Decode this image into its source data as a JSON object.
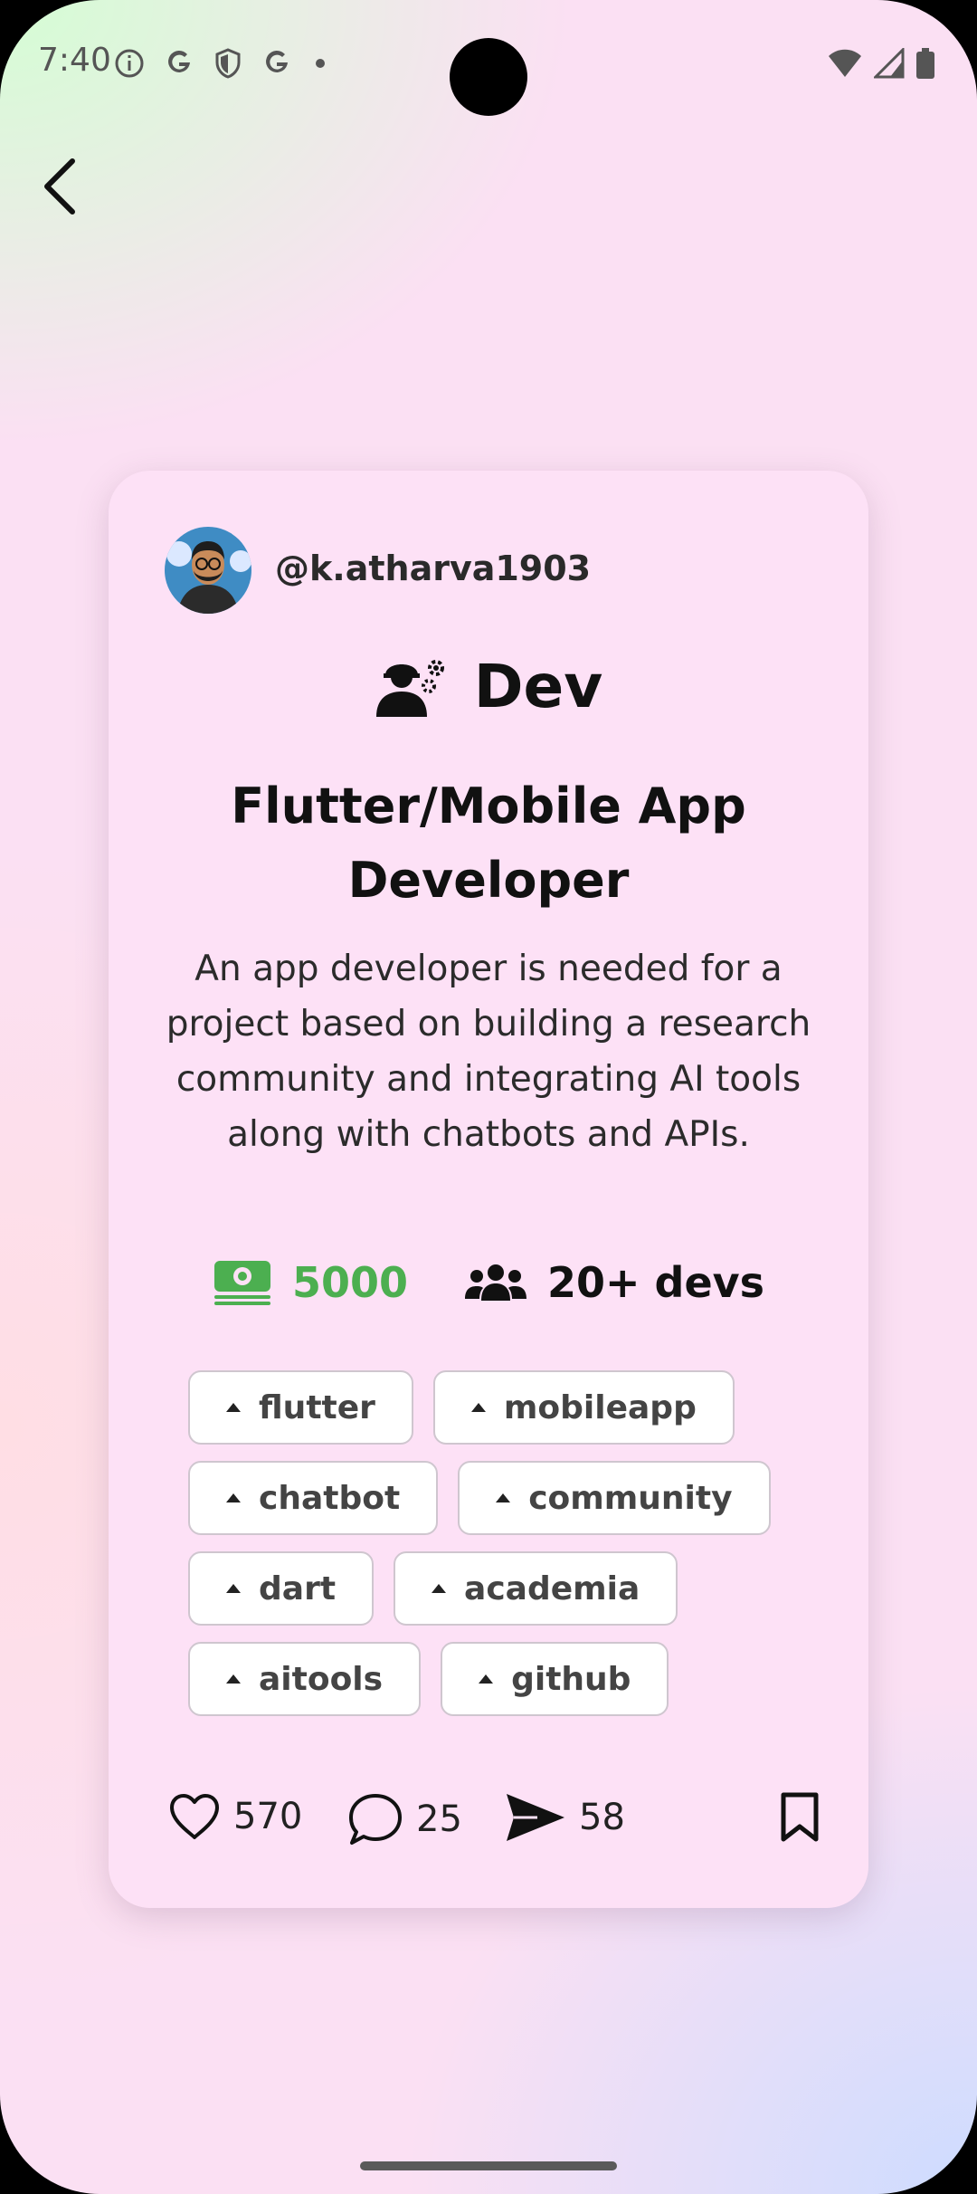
{
  "status_bar": {
    "time": "7:40",
    "left_icons": [
      "info-icon",
      "google-icon",
      "shield-icon",
      "google-icon",
      "dot-icon"
    ],
    "right_icons": [
      "wifi-icon",
      "signal-icon",
      "battery-icon"
    ]
  },
  "nav": {
    "back_icon": "chevron-left-icon"
  },
  "post": {
    "username": "@k.atharva1903",
    "role_icon": "engineer-gear-icon",
    "role": "Dev",
    "title": "Flutter/Mobile App Developer",
    "description": "An app developer is needed for a project based on building a research community and integrating AI tools along with chatbots and APIs.",
    "budget_icon": "money-icon",
    "budget": "5000",
    "team_icon": "users-icon",
    "team_size": "20+ devs",
    "tags": [
      "flutter",
      "mobileapp",
      "chatbot",
      "community",
      "dart",
      "academia",
      "aitools",
      "github"
    ],
    "likes": "570",
    "comments": "25",
    "shares": "58"
  },
  "colors": {
    "accent_green": "#4caf50",
    "card_bg": "#fde1f6"
  }
}
